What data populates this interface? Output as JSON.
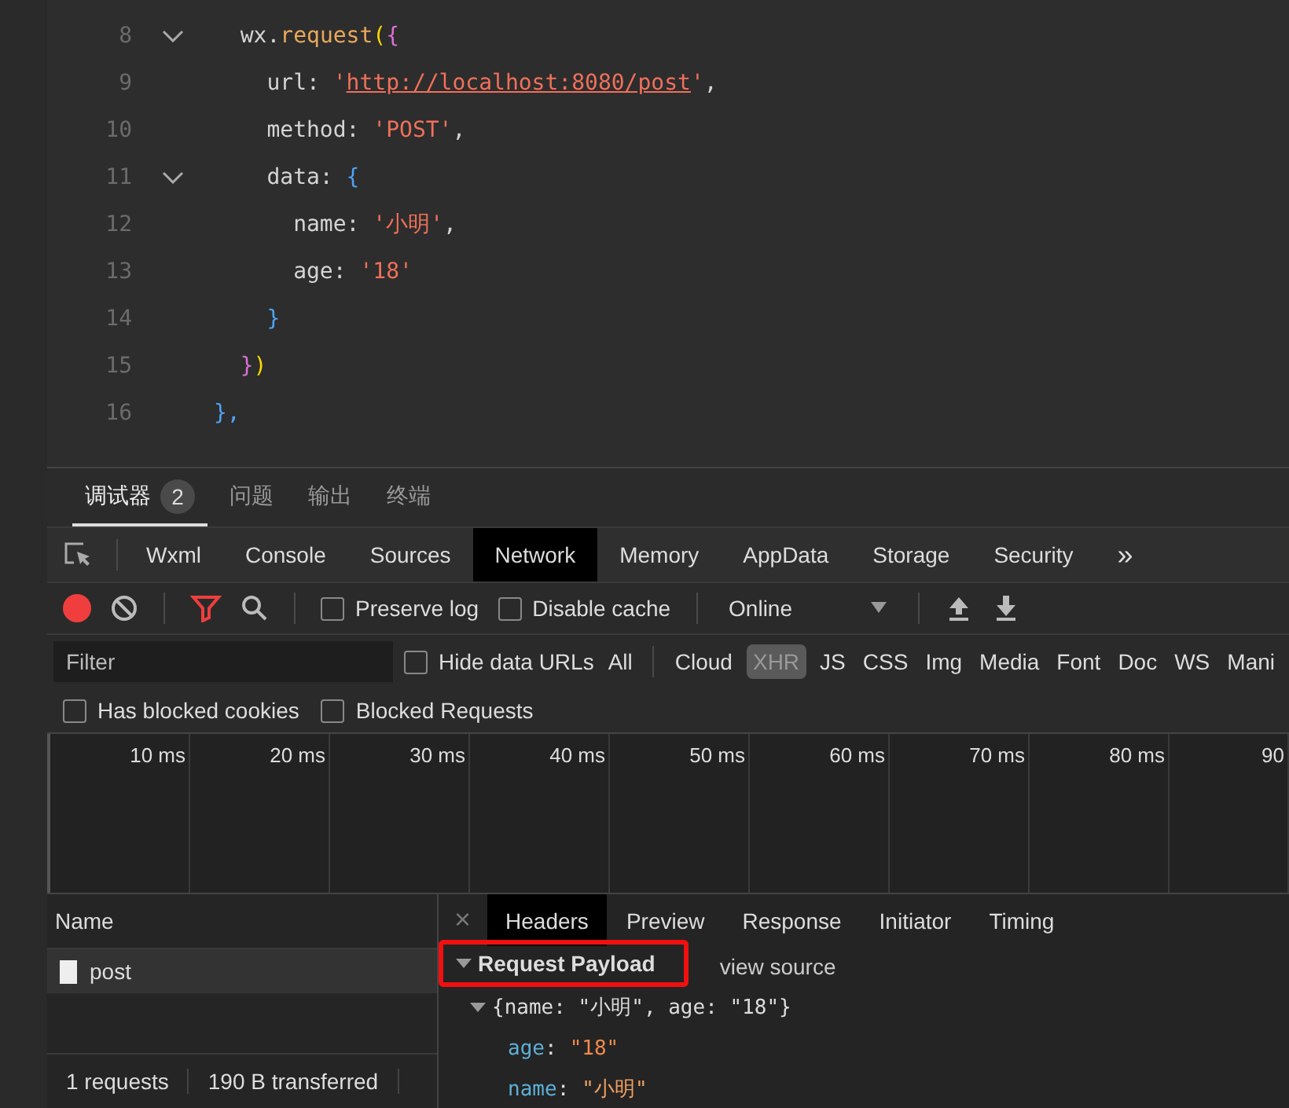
{
  "editor": {
    "lines": [
      {
        "number": "8",
        "fold": true,
        "tokens": [
          {
            "text": "  wx.",
            "kind": "plain"
          },
          {
            "text": "request",
            "kind": "fn"
          },
          {
            "text": "(",
            "kind": "b1"
          },
          {
            "text": "{",
            "kind": "b2"
          }
        ]
      },
      {
        "number": "9",
        "fold": false,
        "tokens": [
          {
            "text": "    url: ",
            "kind": "plain"
          },
          {
            "text": "'",
            "kind": "string"
          },
          {
            "text": "http://localhost:8080/post",
            "kind": "link"
          },
          {
            "text": "'",
            "kind": "string"
          },
          {
            "text": ",",
            "kind": "plain"
          }
        ]
      },
      {
        "number": "10",
        "fold": false,
        "tokens": [
          {
            "text": "    method: ",
            "kind": "plain"
          },
          {
            "text": "'POST'",
            "kind": "string"
          },
          {
            "text": ",",
            "kind": "plain"
          }
        ]
      },
      {
        "number": "11",
        "fold": true,
        "tokens": [
          {
            "text": "    data: ",
            "kind": "plain"
          },
          {
            "text": "{",
            "kind": "b3"
          }
        ]
      },
      {
        "number": "12",
        "fold": false,
        "tokens": [
          {
            "text": "      name: ",
            "kind": "plain"
          },
          {
            "text": "'小明'",
            "kind": "string"
          },
          {
            "text": ",",
            "kind": "plain"
          }
        ]
      },
      {
        "number": "13",
        "fold": false,
        "tokens": [
          {
            "text": "      age: ",
            "kind": "plain"
          },
          {
            "text": "'18'",
            "kind": "string"
          }
        ]
      },
      {
        "number": "14",
        "fold": false,
        "tokens": [
          {
            "text": "    }",
            "kind": "b3"
          }
        ]
      },
      {
        "number": "15",
        "fold": false,
        "tokens": [
          {
            "text": "  }",
            "kind": "b2"
          },
          {
            "text": ")",
            "kind": "b1"
          }
        ]
      },
      {
        "number": "16",
        "fold": false,
        "tokens": [
          {
            "text": "},",
            "kind": "b3"
          }
        ]
      }
    ]
  },
  "drawer_tabs": [
    {
      "label": "调试器",
      "badge": "2",
      "selected": true
    },
    {
      "label": "问题",
      "selected": false
    },
    {
      "label": "输出",
      "selected": false
    },
    {
      "label": "终端",
      "selected": false
    }
  ],
  "panel_tabs": [
    {
      "label": "Wxml",
      "selected": false
    },
    {
      "label": "Console",
      "selected": false
    },
    {
      "label": "Sources",
      "selected": false
    },
    {
      "label": "Network",
      "selected": true
    },
    {
      "label": "Memory",
      "selected": false
    },
    {
      "label": "AppData",
      "selected": false
    },
    {
      "label": "Storage",
      "selected": false
    },
    {
      "label": "Security",
      "selected": false
    }
  ],
  "more_tabs": "»",
  "toolbar": {
    "recording": true,
    "preserve_log": {
      "label": "Preserve log",
      "checked": false
    },
    "disable_cache": {
      "label": "Disable cache",
      "checked": false
    },
    "throttle": "Online"
  },
  "filter": {
    "placeholder": "Filter",
    "hide_data_urls": {
      "label": "Hide data URLs",
      "checked": false
    },
    "types": [
      {
        "label": "All",
        "selected": false
      },
      {
        "label": "Cloud",
        "selected": false
      },
      {
        "label": "XHR",
        "selected": true
      },
      {
        "label": "JS",
        "selected": false
      },
      {
        "label": "CSS",
        "selected": false
      },
      {
        "label": "Img",
        "selected": false
      },
      {
        "label": "Media",
        "selected": false
      },
      {
        "label": "Font",
        "selected": false
      },
      {
        "label": "Doc",
        "selected": false
      },
      {
        "label": "WS",
        "selected": false
      },
      {
        "label": "Mani",
        "selected": false
      }
    ]
  },
  "blocked": [
    {
      "label": "Has blocked cookies",
      "checked": false
    },
    {
      "label": "Blocked Requests",
      "checked": false
    }
  ],
  "timeline_ticks": [
    "10 ms",
    "20 ms",
    "30 ms",
    "40 ms",
    "50 ms",
    "60 ms",
    "70 ms",
    "80 ms",
    "90"
  ],
  "requests": {
    "column": "Name",
    "rows": [
      {
        "name": "post",
        "selected": true
      }
    ],
    "status": [
      "1 requests",
      "190 B transferred"
    ]
  },
  "details": {
    "close": "×",
    "tabs": [
      {
        "label": "Headers",
        "selected": true
      },
      {
        "label": "Preview",
        "selected": false
      },
      {
        "label": "Response",
        "selected": false
      },
      {
        "label": "Initiator",
        "selected": false
      },
      {
        "label": "Timing",
        "selected": false
      }
    ],
    "section": {
      "title": "Request Payload",
      "expanded": true,
      "highlighted": true,
      "view_source": "view source",
      "summary": "{name: \"小明\", age: \"18\"}",
      "expanded_summary": true,
      "fields": [
        {
          "key": "age",
          "separator": ":",
          "value": "\"18\"",
          "kind": "number"
        },
        {
          "key": "name",
          "separator": ":",
          "value": "\"小明\"",
          "kind": "string"
        }
      ]
    }
  }
}
